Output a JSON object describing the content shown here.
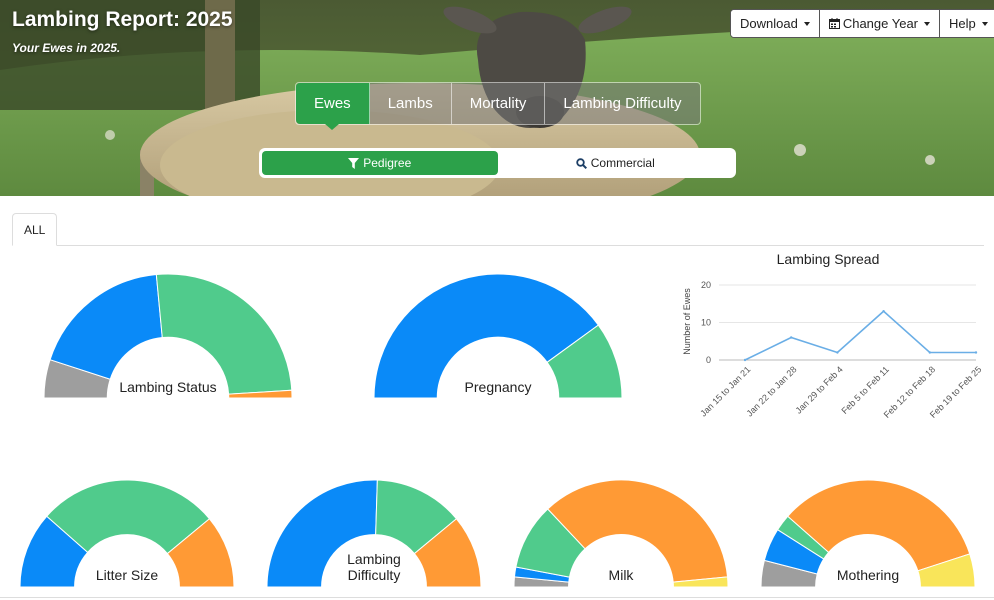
{
  "header": {
    "title": "Lambing Report: 2025",
    "subtitle": "Your Ewes in 2025."
  },
  "menu": {
    "download": "Download",
    "change_year": "Change Year",
    "help": "Help"
  },
  "main_tabs": [
    "Ewes",
    "Lambs",
    "Mortality",
    "Lambing Difficulty"
  ],
  "active_main_tab": "Ewes",
  "type_toggle": {
    "pedigree": "Pedigree",
    "commercial": "Commercial",
    "active": "Pedigree"
  },
  "sub_tabs": [
    "ALL"
  ],
  "colors": {
    "blue": "#0a8af8",
    "green": "#50cb8c",
    "orange": "#ff9a35",
    "gray": "#9e9e9e",
    "yellow": "#f9e55a",
    "accent": "#2ca14a"
  },
  "gauges": [
    {
      "label": "Lambing Status",
      "segments": [
        {
          "color": "#9e9e9e",
          "value": 10
        },
        {
          "color": "#0a8af8",
          "value": 37
        },
        {
          "color": "#50cb8c",
          "value": 51
        },
        {
          "color": "#ff9a35",
          "value": 2
        }
      ]
    },
    {
      "label": "Pregnancy",
      "segments": [
        {
          "color": "#0a8af8",
          "value": 80
        },
        {
          "color": "#50cb8c",
          "value": 20
        }
      ]
    },
    {
      "label": "Litter Size",
      "segments": [
        {
          "color": "#0a8af8",
          "value": 23
        },
        {
          "color": "#50cb8c",
          "value": 55
        },
        {
          "color": "#ff9a35",
          "value": 22
        }
      ]
    },
    {
      "label": "Lambing Difficulty",
      "segments": [
        {
          "color": "#0a8af8",
          "value": 51
        },
        {
          "color": "#50cb8c",
          "value": 27
        },
        {
          "color": "#ff9a35",
          "value": 22
        }
      ]
    },
    {
      "label": "Milk",
      "segments": [
        {
          "color": "#9e9e9e",
          "value": 3
        },
        {
          "color": "#0a8af8",
          "value": 3
        },
        {
          "color": "#50cb8c",
          "value": 20
        },
        {
          "color": "#ff9a35",
          "value": 71
        },
        {
          "color": "#f9e55a",
          "value": 3
        }
      ]
    },
    {
      "label": "Mothering",
      "segments": [
        {
          "color": "#9e9e9e",
          "value": 8
        },
        {
          "color": "#0a8af8",
          "value": 10
        },
        {
          "color": "#50cb8c",
          "value": 5
        },
        {
          "color": "#ff9a35",
          "value": 67
        },
        {
          "color": "#f9e55a",
          "value": 10
        }
      ]
    }
  ],
  "chart_data": {
    "type": "line",
    "title": "Lambing Spread",
    "xlabel": "",
    "ylabel": "Number of Ewes",
    "categories": [
      "Jan 15 to Jan 21",
      "Jan 22 to Jan 28",
      "Jan 29 to Feb 4",
      "Feb 5 to Feb 11",
      "Feb 12 to Feb 18",
      "Feb 19 to Feb 25"
    ],
    "series": [
      {
        "values": [
          0,
          6,
          2,
          13,
          2,
          2
        ],
        "color": "#6aaee6"
      }
    ],
    "ylim": [
      0,
      20
    ],
    "yticks": [
      0,
      10,
      20
    ],
    "grid": true
  }
}
